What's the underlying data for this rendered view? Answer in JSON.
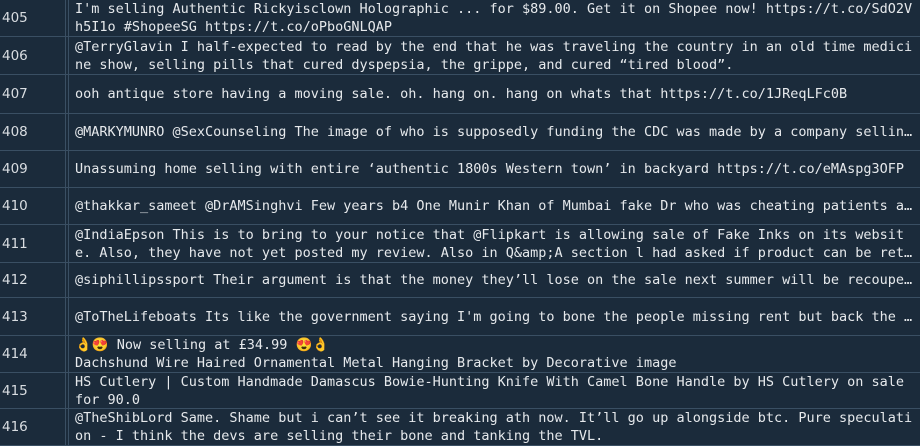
{
  "rows": [
    {
      "index": "405",
      "text": "I'm selling Authentic Rickyisclown Holographic ... for $89.00. Get it on Shopee now! https://t.co/SdO2Vh5I1o #ShopeeSG https://t.co/oPboGNLQAP"
    },
    {
      "index": "406",
      "text": "@TerryGlavin I half-expected to read by the end that he was traveling the country in an old time medicine show, selling pills that cured dyspepsia, the grippe, and cured “tired blood”."
    },
    {
      "index": "407",
      "text": "ooh antique store having a moving sale. oh. hang on. hang on whats that https://t.co/1JReqLFc0B"
    },
    {
      "index": "408",
      "text": "@MARKYMUNRO @SexCounseling The image of who is supposedly funding the CDC was made by a company selling fake images"
    },
    {
      "index": "409",
      "text": "Unassuming home selling with entire ‘authentic 1800s Western town’ in backyard https://t.co/eMAspg3OFP"
    },
    {
      "index": "410",
      "text": "@thakkar_sameet @DrAMSinghvi Few years b4 One Munir Khan of Mumbai  fake Dr who was cheating patients and selling"
    },
    {
      "index": "411",
      "text": "@IndiaEpson This is to bring to your notice that @Flipkart is allowing sale of Fake Inks on its website. Also, they have not yet posted my review. Also in Q&amp;A section l had asked if product can be returned"
    },
    {
      "index": "412",
      "text": "@siphillipssport Their argument is that the money they’ll lose on the sale next summer will be recouped later"
    },
    {
      "index": "413",
      "text": "@ToTheLifeboats Its like the government saying I'm going to bone the people missing rent but back the landlords"
    },
    {
      "index": "414",
      "text": "👌😍 Now selling at £34.99 😍👌\nDachshund Wire Haired Ornamental Metal Hanging Bracket by Decorative image"
    },
    {
      "index": "415",
      "text": "HS Cutlery | Custom Handmade Damascus Bowie-Hunting Knife With Camel Bone Handle by HS Cutlery on sale for 90.0"
    },
    {
      "index": "416",
      "text": "@TheShibLord Same. Shame but i can’t see it breaking ath now. It’ll go up alongside btc. Pure speculation - I think the devs are selling their bone and tanking the TVL."
    }
  ]
}
